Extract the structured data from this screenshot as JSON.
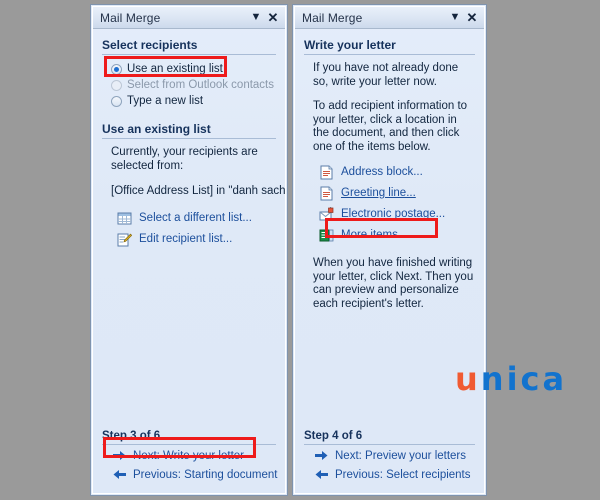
{
  "app": {
    "background_color": "#9a9a9a",
    "pane_color": "#dfe9f7",
    "accent_link_color": "#1c4f9c",
    "highlight_color": "#ee1b1b"
  },
  "watermark": {
    "first_letter": "u",
    "rest": "nica",
    "first_letter_color": "#f05a32",
    "rest_color": "#1273ce"
  },
  "left_pane": {
    "title": "Mail Merge",
    "dropdown_icon": "chevron-down-icon",
    "close_icon": "close-icon",
    "section_heading": "Select recipients",
    "radios": [
      {
        "label": "Use an existing list",
        "checked": true,
        "disabled": false,
        "highlighted": true
      },
      {
        "label": "Select from Outlook contacts",
        "checked": false,
        "disabled": true,
        "highlighted": false
      },
      {
        "label": "Type a new list",
        "checked": false,
        "disabled": false,
        "highlighted": false
      }
    ],
    "subsection_heading": "Use an existing list",
    "paragraph": "Currently, your recipients are selected from:",
    "source_line": "[Office Address List] in \"danh sach.m",
    "links": [
      {
        "label": "Select a different list...",
        "icon": "table-grid-icon",
        "underlined": false
      },
      {
        "label": "Edit recipient list...",
        "icon": "edit-pencil-icon",
        "underlined": false
      }
    ],
    "step_label": "Step 3 of 6",
    "nav": [
      {
        "label": "Next: Write your letter",
        "icon": "arrow-right-icon",
        "highlighted": true
      },
      {
        "label": "Previous: Starting document",
        "icon": "arrow-left-icon",
        "highlighted": false
      }
    ]
  },
  "right_pane": {
    "title": "Mail Merge",
    "dropdown_icon": "chevron-down-icon",
    "close_icon": "close-icon",
    "section_heading": "Write your letter",
    "paragraph_1": "If you have not already done so, write your letter now.",
    "paragraph_2": "To add recipient information to your letter, click a location in the document, and then click one of the items below.",
    "links": [
      {
        "label": "Address block...",
        "icon": "document-icon",
        "underlined": false,
        "highlighted": false
      },
      {
        "label": "Greeting line...",
        "icon": "document-icon",
        "underlined": true,
        "highlighted": false
      },
      {
        "label": "Electronic postage...",
        "icon": "envelope-stamp-icon",
        "underlined": false,
        "highlighted": false
      },
      {
        "label": "More items...",
        "icon": "fields-list-icon",
        "underlined": false,
        "highlighted": true
      }
    ],
    "paragraph_3": "When you have finished writing your letter, click Next. Then you can preview and personalize each recipient's letter.",
    "step_label": "Step 4 of 6",
    "nav": [
      {
        "label": "Next: Preview your letters",
        "icon": "arrow-right-icon",
        "highlighted": false
      },
      {
        "label": "Previous: Select recipients",
        "icon": "arrow-left-icon",
        "highlighted": false
      }
    ]
  }
}
